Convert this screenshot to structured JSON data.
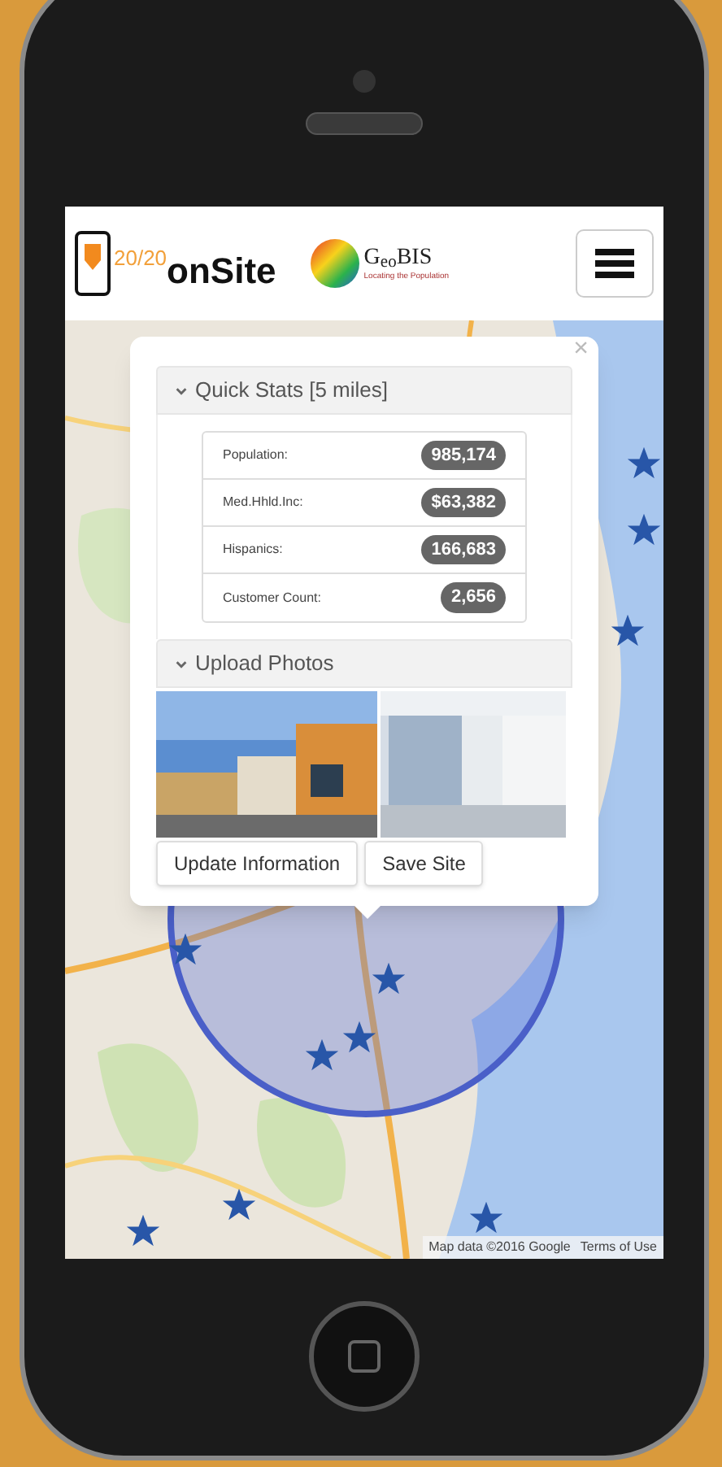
{
  "header": {
    "brand": {
      "mark": "20/20",
      "name": "onSite"
    },
    "partner_logo": {
      "name": "G$_{eo}$BIS",
      "tagline": "Locating the Population"
    }
  },
  "popup": {
    "close": "×",
    "sections": [
      {
        "title": "Quick Stats [5 miles]",
        "expanded": true,
        "stats": [
          {
            "label": "Population:",
            "value": "985,174"
          },
          {
            "label": "Med.Hhld.Inc:",
            "value": "$63,382"
          },
          {
            "label": "Hispanics:",
            "value": "166,683"
          },
          {
            "label": "Customer Count:",
            "value": "2,656"
          }
        ]
      },
      {
        "title": "Upload Photos",
        "expanded": true
      }
    ],
    "buttons": [
      "Update Information",
      "Save Site"
    ]
  },
  "map": {
    "attribution": "Map data ©2016 Google",
    "terms": "Terms of Use"
  }
}
